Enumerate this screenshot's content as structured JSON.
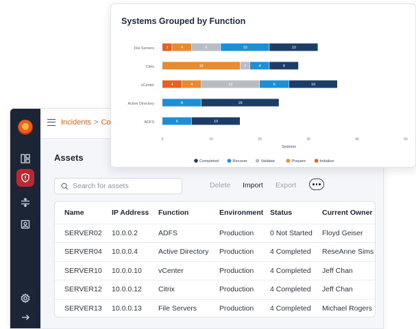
{
  "breadcrumb": {
    "part1": "Incidents",
    "separator": ">",
    "part2": "Comp"
  },
  "page_title": "Assets",
  "search": {
    "placeholder": "Search for assets",
    "value": ""
  },
  "toolbar": {
    "delete_label": "Delete",
    "import_label": "Import",
    "export_label": "Export"
  },
  "sidebar": {
    "items": [
      "dashboard-icon",
      "alert-icon",
      "transfer-icon",
      "contact-icon",
      "settings-icon",
      "arrow-right-icon"
    ]
  },
  "table": {
    "columns": [
      "Name",
      "IP Address",
      "Function",
      "Environment",
      "Status",
      "Current Owner"
    ],
    "rows": [
      [
        "SERVER02",
        "10.0.0.2",
        "ADFS",
        "Production",
        "0 Not Started",
        "Floyd Geiser"
      ],
      [
        "SERVER04",
        "10.0.0.4",
        "Active Directory",
        "Production",
        "4 Completed",
        "ReseAnne Sims"
      ],
      [
        "SERVER10",
        "10.0.0.10",
        "vCenter",
        "Production",
        "4 Completed",
        "Jeff Chan"
      ],
      [
        "SERVER12",
        "10.0.0.12",
        "Citrix",
        "Production",
        "4 Completed",
        "Jeff Chan"
      ],
      [
        "SERVER13",
        "10.0.0.13",
        "File Servers",
        "Production",
        "4 Completed",
        "Michael Rogers"
      ]
    ]
  },
  "colors": {
    "accent": "#e8601c",
    "sidebar": "#1b2536",
    "active": "#b92a30"
  },
  "chart_data": {
    "type": "bar",
    "orientation": "horizontal",
    "stacked": true,
    "title": "Systems Grouped by Function",
    "xlabel": "Systems",
    "ylabel": "",
    "xlim": [
      0,
      50
    ],
    "xticks": [
      0,
      10,
      20,
      30,
      40,
      50
    ],
    "categories": [
      "File Servers",
      "Citrix",
      "vCenter",
      "Active Directory",
      "ADFS"
    ],
    "series": [
      {
        "name": "Initialize",
        "color": "#e8601c",
        "values": [
          2,
          0,
          4,
          0,
          0
        ]
      },
      {
        "name": "Prepare",
        "color": "#e88a2e",
        "values": [
          4,
          16,
          4,
          0,
          0
        ]
      },
      {
        "name": "Validate",
        "color": "#b8bcc3",
        "values": [
          6,
          2,
          12,
          0,
          0
        ]
      },
      {
        "name": "Recover",
        "color": "#1c8fd6",
        "values": [
          10,
          4,
          6,
          8,
          6
        ]
      },
      {
        "name": "Completed",
        "color": "#1c3d66",
        "values": [
          10,
          6,
          10,
          16,
          10
        ]
      }
    ],
    "legend_order": [
      "Completed",
      "Recover",
      "Validate",
      "Prepare",
      "Initialize"
    ],
    "legend_position": "bottom",
    "grid": false
  }
}
